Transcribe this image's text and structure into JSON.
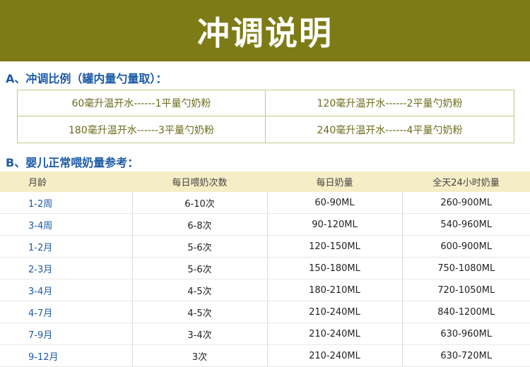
{
  "banner": {
    "title": "冲调说明"
  },
  "section_a": {
    "heading": "A、冲调比例（罐内量勺量取）：",
    "cells": [
      "60毫升温开水------1平量勺奶粉",
      "120毫升温开水------2平量勺奶粉",
      "180毫升温开水------3平量勺奶粉",
      "240毫升温开水------4平量勺奶粉"
    ]
  },
  "section_b": {
    "heading": "B、婴儿正常喂奶量参考：",
    "columns": [
      "月龄",
      "每日喂奶次数",
      "每日奶量",
      "全天24小时奶量"
    ],
    "rows": [
      [
        "1-2周",
        "6-10次",
        "60-90ML",
        "260-900ML"
      ],
      [
        "3-4周",
        "6-8次",
        "90-120ML",
        "540-960ML"
      ],
      [
        "1-2月",
        "5-6次",
        "120-150ML",
        "600-900ML"
      ],
      [
        "2-3月",
        "5-6次",
        "150-180ML",
        "750-1080ML"
      ],
      [
        "3-4月",
        "4-5次",
        "180-210ML",
        "720-1050ML"
      ],
      [
        "4-7月",
        "4-5次",
        "210-240ML",
        "840-1200ML"
      ],
      [
        "7-9月",
        "3-4次",
        "210-240ML",
        "630-960ML"
      ],
      [
        "9-12月",
        "3次",
        "210-240ML",
        "630-720ML"
      ]
    ]
  },
  "colors": {
    "banner": "#7d7b15",
    "heading": "#1b5aa6",
    "ratio_text": "#6b6b1b",
    "table_header": "#f5edc6"
  }
}
